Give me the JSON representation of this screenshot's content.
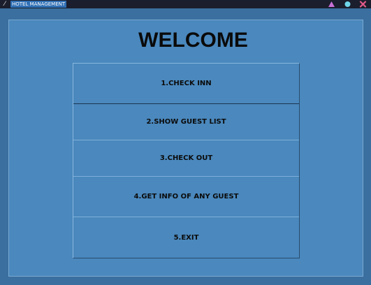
{
  "window": {
    "title": "HOTEL MANAGEMENT",
    "app_icon": "feather-icon",
    "controls": [
      {
        "name": "triangle-icon",
        "color": "#c970d6"
      },
      {
        "name": "circle-icon",
        "color": "#6fd6ea"
      },
      {
        "name": "close-x-icon",
        "color": "#e35a8a"
      }
    ]
  },
  "main": {
    "heading": "WELCOME",
    "menu": [
      {
        "label": "1.CHECK INN"
      },
      {
        "label": "2.SHOW GUEST LIST"
      },
      {
        "label": "3.CHECK OUT"
      },
      {
        "label": "4.GET INFO OF ANY GUEST"
      },
      {
        "label": "5.EXIT"
      }
    ]
  },
  "colors": {
    "background": "#3f74a6",
    "panel": "#4a88bd",
    "titlebar": "#1b1e2c",
    "title_highlight": "#2f6fb4"
  }
}
